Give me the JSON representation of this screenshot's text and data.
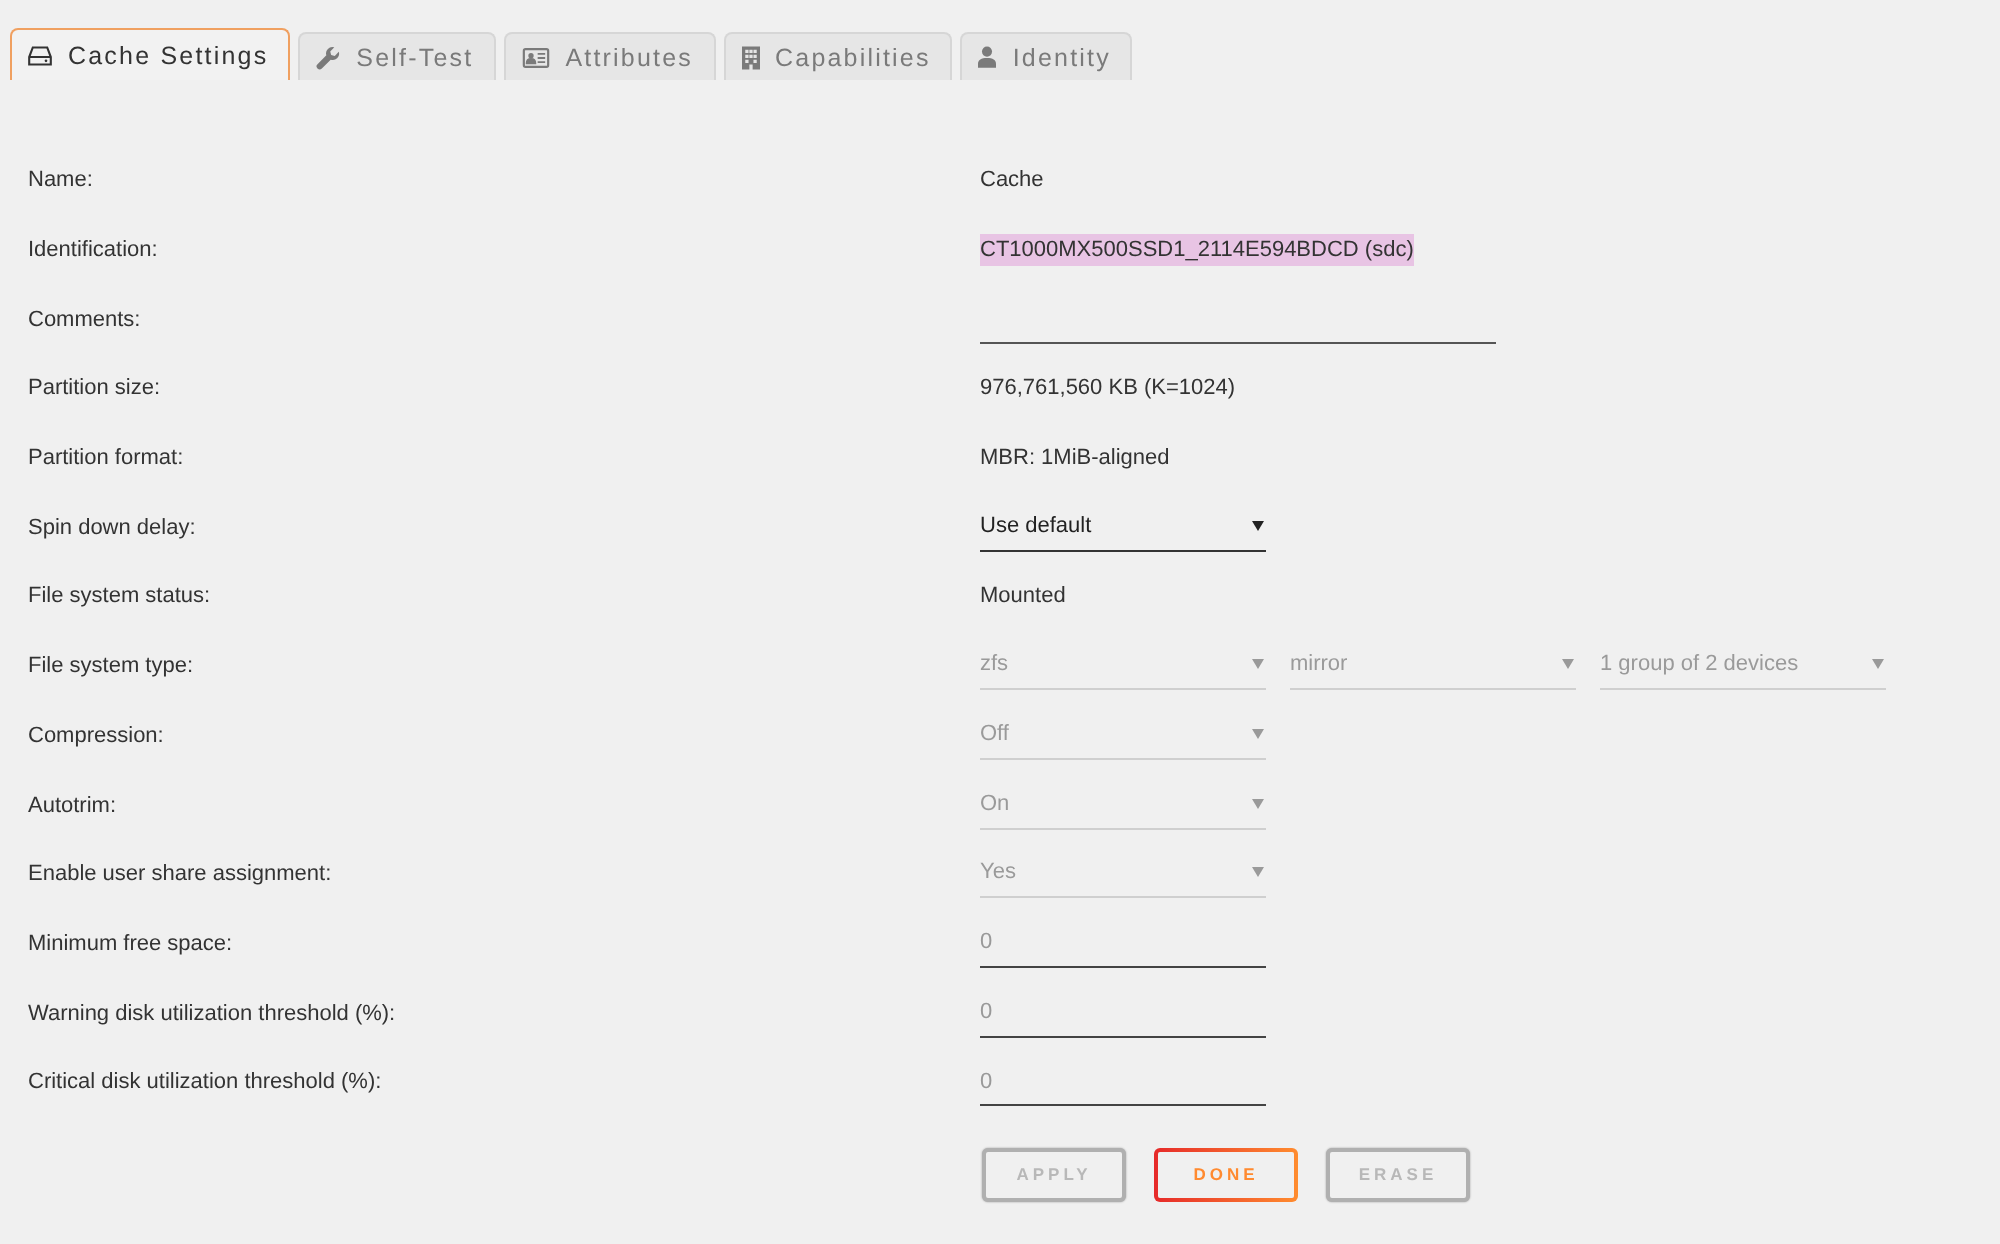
{
  "tabs": [
    {
      "label": "Cache Settings",
      "selected": true
    },
    {
      "label": "Self-Test",
      "selected": false
    },
    {
      "label": "Attributes",
      "selected": false
    },
    {
      "label": "Capabilities",
      "selected": false
    },
    {
      "label": "Identity",
      "selected": false
    }
  ],
  "settings": [
    {
      "label": "Name:",
      "kind": "text",
      "value": "Cache",
      "highlighted": false
    },
    {
      "label": "Identification:",
      "kind": "text",
      "value": "CT1000MX500SSD1_2114E594BDCD (sdc)",
      "highlighted": true
    },
    {
      "label": "Comments:",
      "kind": "input"
    },
    {
      "label": "Partition size:",
      "kind": "text",
      "value": "976,761,560 KB (K=1024)",
      "highlighted": false
    },
    {
      "label": "Partition format:",
      "kind": "text",
      "value": "MBR: 1MiB-aligned",
      "highlighted": false
    },
    {
      "label": "Spin down delay:",
      "kind": "select",
      "selects": [
        {
          "value": "Use default",
          "disabled": false
        }
      ]
    },
    {
      "label": "File system status:",
      "kind": "text",
      "value": "Mounted",
      "highlighted": false
    },
    {
      "label": "File system type:",
      "kind": "select",
      "selects": [
        {
          "value": "zfs",
          "disabled": true
        },
        {
          "value": "mirror",
          "disabled": true
        },
        {
          "value": "1 group of 2 devices",
          "disabled": true
        }
      ]
    },
    {
      "label": "Compression:",
      "kind": "select",
      "selects": [
        {
          "value": "Off",
          "disabled": true
        }
      ]
    },
    {
      "label": "Autotrim:",
      "kind": "select",
      "selects": [
        {
          "value": "On",
          "disabled": true
        }
      ]
    },
    {
      "label": "Enable user share assignment:",
      "kind": "select",
      "selects": [
        {
          "value": "Yes",
          "disabled": true
        }
      ]
    },
    {
      "label": "Minimum free space:",
      "kind": "number",
      "placeholder": "0"
    },
    {
      "label": "Warning disk utilization threshold (%):",
      "kind": "number",
      "placeholder": "0"
    },
    {
      "label": "Critical disk utilization threshold (%):",
      "kind": "number",
      "placeholder": "0"
    }
  ],
  "buttons": [
    {
      "label": "APPLY",
      "disabled": true
    },
    {
      "label": "DONE",
      "disabled": false
    },
    {
      "label": "ERASE",
      "disabled": true
    }
  ]
}
